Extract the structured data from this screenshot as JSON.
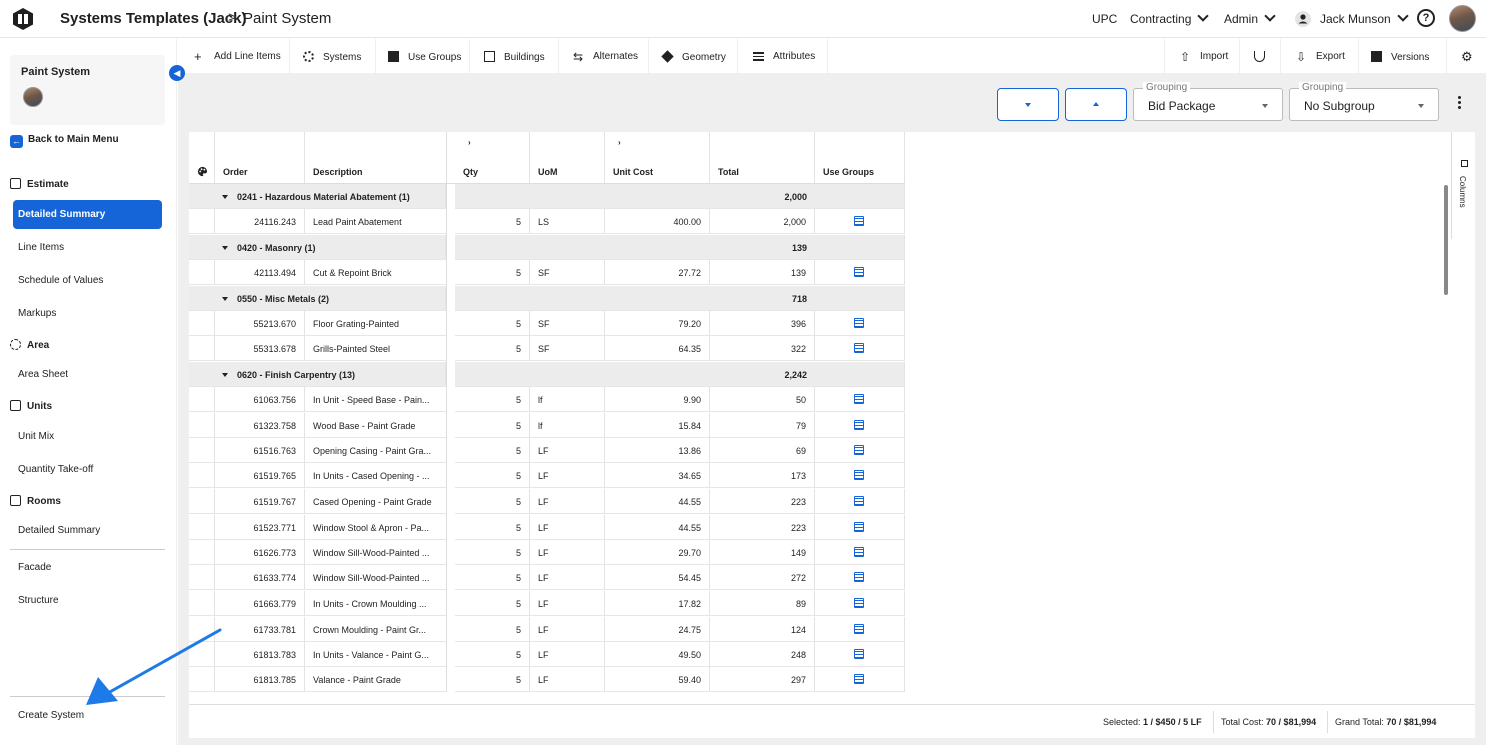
{
  "header": {
    "breadcrumb_parent": "Systems Templates (Jack)",
    "breadcrumb_sep": ">",
    "breadcrumb_current": "Paint System",
    "company": "UPC",
    "contracting": "Contracting",
    "admin": "Admin",
    "user_name": "Jack Munson",
    "help": "?"
  },
  "sidebar": {
    "project_title": "Paint System",
    "back": "Back to Main Menu",
    "sections": {
      "estimate": "Estimate",
      "area": "Area",
      "units": "Units",
      "rooms": "Rooms"
    },
    "items": {
      "detailed_summary": "Detailed Summary",
      "line_items": "Line Items",
      "schedule_of_values": "Schedule of Values",
      "markups": "Markups",
      "area_sheet": "Area Sheet",
      "unit_mix": "Unit Mix",
      "quantity_takeoff": "Quantity Take-off",
      "rooms_detailed_summary": "Detailed Summary",
      "facade": "Facade",
      "structure": "Structure",
      "create_system": "Create System"
    }
  },
  "toolbar": {
    "add_line_items": "Add Line Items",
    "systems": "Systems",
    "use_groups": "Use Groups",
    "buildings": "Buildings",
    "alternates": "Alternates",
    "geometry": "Geometry",
    "attributes": "Attributes",
    "import": "Import",
    "export": "Export",
    "versions": "Versions"
  },
  "controls": {
    "grouping_label": "Grouping",
    "grouping_value": "Bid Package",
    "subgroup_label": "Grouping",
    "subgroup_value": "No Subgroup"
  },
  "table": {
    "columns": {
      "order": "Order",
      "description": "Description",
      "qty": "Qty",
      "uom": "UoM",
      "unit_cost": "Unit Cost",
      "total": "Total",
      "use_groups": "Use Groups"
    },
    "mini_marker": "›",
    "rows": [
      {
        "kind": "group",
        "label": "0241 - Hazardous Material Abatement (1)",
        "total": "2,000"
      },
      {
        "kind": "item",
        "order": "24116.243",
        "description": "Lead Paint Abatement",
        "qty": "5",
        "uom": "LS",
        "unit_cost": "400.00",
        "total": "2,000"
      },
      {
        "kind": "group",
        "label": "0420 - Masonry (1)",
        "total": "139"
      },
      {
        "kind": "item",
        "order": "42113.494",
        "description": "Cut & Repoint Brick",
        "qty": "5",
        "uom": "SF",
        "unit_cost": "27.72",
        "total": "139"
      },
      {
        "kind": "group",
        "label": "0550 - Misc Metals (2)",
        "total": "718"
      },
      {
        "kind": "item",
        "order": "55213.670",
        "description": "Floor Grating-Painted",
        "qty": "5",
        "uom": "SF",
        "unit_cost": "79.20",
        "total": "396"
      },
      {
        "kind": "item",
        "order": "55313.678",
        "description": "Grills-Painted Steel",
        "qty": "5",
        "uom": "SF",
        "unit_cost": "64.35",
        "total": "322"
      },
      {
        "kind": "group",
        "label": "0620 - Finish Carpentry (13)",
        "total": "2,242"
      },
      {
        "kind": "item",
        "order": "61063.756",
        "description": "In Unit - Speed Base - Pain...",
        "qty": "5",
        "uom": "lf",
        "unit_cost": "9.90",
        "total": "50"
      },
      {
        "kind": "item",
        "order": "61323.758",
        "description": "Wood Base - Paint Grade",
        "qty": "5",
        "uom": "lf",
        "unit_cost": "15.84",
        "total": "79"
      },
      {
        "kind": "item",
        "order": "61516.763",
        "description": "Opening Casing - Paint Gra...",
        "qty": "5",
        "uom": "LF",
        "unit_cost": "13.86",
        "total": "69"
      },
      {
        "kind": "item",
        "order": "61519.765",
        "description": "In Units - Cased Opening - ...",
        "qty": "5",
        "uom": "LF",
        "unit_cost": "34.65",
        "total": "173"
      },
      {
        "kind": "item",
        "order": "61519.767",
        "description": "Cased Opening - Paint Grade",
        "qty": "5",
        "uom": "LF",
        "unit_cost": "44.55",
        "total": "223"
      },
      {
        "kind": "item",
        "order": "61523.771",
        "description": "Window Stool & Apron - Pa...",
        "qty": "5",
        "uom": "LF",
        "unit_cost": "44.55",
        "total": "223"
      },
      {
        "kind": "item",
        "order": "61626.773",
        "description": "Window Sill-Wood-Painted ...",
        "qty": "5",
        "uom": "LF",
        "unit_cost": "29.70",
        "total": "149"
      },
      {
        "kind": "item",
        "order": "61633.774",
        "description": "Window Sill-Wood-Painted ...",
        "qty": "5",
        "uom": "LF",
        "unit_cost": "54.45",
        "total": "272"
      },
      {
        "kind": "item",
        "order": "61663.779",
        "description": "In Units - Crown Moulding ...",
        "qty": "5",
        "uom": "LF",
        "unit_cost": "17.82",
        "total": "89"
      },
      {
        "kind": "item",
        "order": "61733.781",
        "description": "Crown Moulding - Paint Gr...",
        "qty": "5",
        "uom": "LF",
        "unit_cost": "24.75",
        "total": "124"
      },
      {
        "kind": "item",
        "order": "61813.783",
        "description": "In Units - Valance - Paint G...",
        "qty": "5",
        "uom": "LF",
        "unit_cost": "49.50",
        "total": "248"
      },
      {
        "kind": "item",
        "order": "61813.785",
        "description": "Valance - Paint Grade",
        "qty": "5",
        "uom": "LF",
        "unit_cost": "59.40",
        "total": "297"
      }
    ],
    "columns_panel": "Columns"
  },
  "footer": {
    "selected_label": "Selected:",
    "selected_value": "1 / $450 / 5 LF",
    "total_cost_label": "Total Cost:",
    "total_cost_value": "70 / $81,994",
    "grand_total_label": "Grand Total:",
    "grand_total_value": "70 / $81,994"
  },
  "colors": {
    "accent": "#1565d8",
    "group_row": "#ececec",
    "background": "#efefef"
  }
}
